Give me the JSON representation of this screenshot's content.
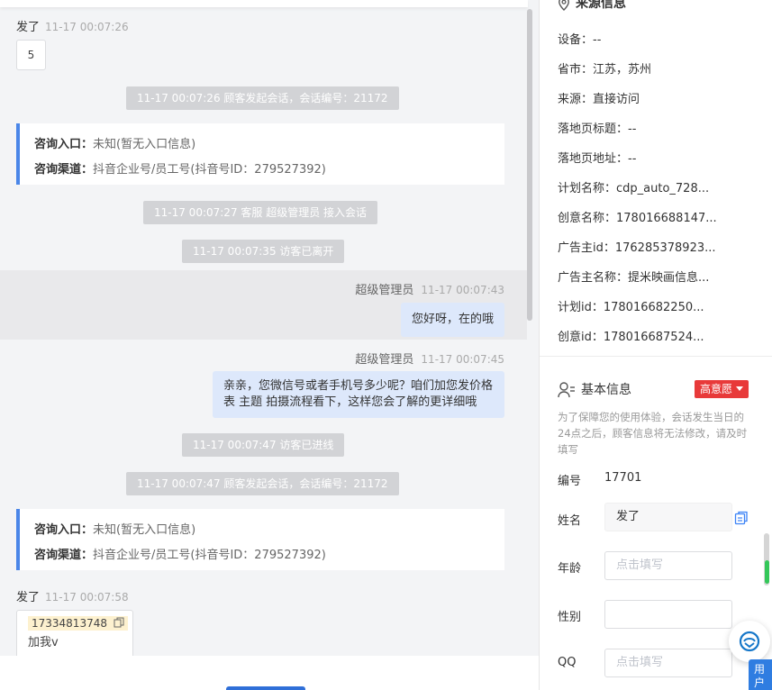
{
  "chat": {
    "messages": [
      {
        "name": "发了",
        "time": "11-17 00:07:26",
        "text": "5"
      },
      {
        "system": "11-17 00:07:26 顾客发起会话，会话编号：21172"
      },
      {
        "consult": {
          "entry_label": "咨询入口：",
          "entry_value": "未知(暂无入口信息)",
          "channel_label": "咨询渠道：",
          "channel_value": "抖音企业号/员工号(抖音号ID：279527392)"
        }
      },
      {
        "system": "11-17 00:07:27 客服 超级管理员 接入会话"
      },
      {
        "system": "11-17 00:07:35 访客已离开"
      },
      {
        "name": "超级管理员",
        "time": "11-17 00:07:43",
        "text": "您好呀，在的哦"
      },
      {
        "name": "超级管理员",
        "time": "11-17 00:07:45",
        "text": "亲亲，您微信号或者手机号多少呢？咱们加您发价格表 主题 拍摄流程看下，这样您会了解的更详细哦"
      },
      {
        "system": "11-17 00:07:47 访客已进线"
      },
      {
        "system": "11-17 00:07:47 顾客发起会话，会话编号：21172"
      },
      {
        "consult": {
          "entry_label": "咨询入口：",
          "entry_value": "未知(暂无入口信息)",
          "channel_label": "咨询渠道：",
          "channel_value": "抖音企业号/员工号(抖音号ID：279527392)"
        }
      },
      {
        "name": "发了",
        "time": "11-17 00:07:58",
        "phone": "17334813748",
        "text": "加我v"
      }
    ]
  },
  "source": {
    "title": "来源信息",
    "rows": [
      "设备：--",
      "省市：江苏，苏州",
      "来源：直接访问",
      "落地页标题：--",
      "落地页地址：--",
      "计划名称：cdp_auto_728...",
      "创意名称：178016688147...",
      "广告主id：176285378923...",
      "广告主名称：提米映画信息...",
      "计划id：178016682250...",
      "创意id：178016687524..."
    ]
  },
  "basic": {
    "title": "基本信息",
    "intent": "高意愿",
    "note": "为了保障您的使用体验，会话发生当日的24点之后，顾客信息将无法修改，请及时填写",
    "id_label": "编号",
    "id_value": "17701",
    "name_label": "姓名",
    "name_value": "发了",
    "age_label": "年龄",
    "age_placeholder": "点击填写",
    "gender_label": "性别",
    "qq_label": "QQ",
    "qq_placeholder": "点击填写"
  },
  "side_tab": "用户后"
}
